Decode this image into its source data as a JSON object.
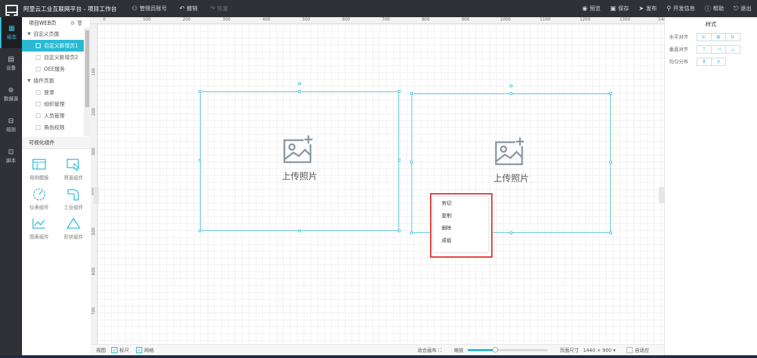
{
  "topbar": {
    "title": "阿里云工业互联网平台 - 项目工作台",
    "admin": "管理员账号",
    "undo": "撤销",
    "redo": "恢复",
    "preview": "预览",
    "save": "保存",
    "publish": "发布",
    "devinfo": "开发信息",
    "help": "帮助",
    "logout": "退出"
  },
  "iconbar": [
    "组态",
    "设备",
    "数据源",
    "规则",
    "脚本"
  ],
  "tree": {
    "header": "项目WEB页",
    "group1": "自定义页面",
    "group1_items": [
      "自定义新增页1",
      "自定义新增页2",
      "OEE服务"
    ],
    "group2": "插件页面",
    "group2_items": [
      "登录",
      "组织管理",
      "人员管理",
      "角色权限"
    ]
  },
  "components": {
    "header": "可视化组件",
    "items": [
      "用例模板",
      "界面组件",
      "仪表组件",
      "工业组件",
      "图表组件",
      "形状组件"
    ]
  },
  "ruler": {
    "x": [
      "0",
      "100",
      "200",
      "300",
      "400",
      "500",
      "600",
      "700",
      "800",
      "900",
      "1000",
      "1100",
      "1200",
      "1300",
      "140"
    ],
    "y": [
      "100",
      "200",
      "300",
      "400",
      "500",
      "600",
      "700"
    ]
  },
  "canvas": {
    "upload_label_1": "上传照片",
    "upload_label_2": "上传照片"
  },
  "context_menu": [
    "剪切",
    "复制",
    "删除",
    "成组"
  ],
  "right_panel": {
    "title": "样式",
    "h_align": "水平对齐",
    "v_align": "垂直对齐",
    "distribute": "均匀分布"
  },
  "bottombar": {
    "view": "视图",
    "ruler": "标尺",
    "grid": "网格",
    "fit": "适合画布",
    "zoom": "缩放",
    "zoom_level": 0.35,
    "page_size_label": "页面尺寸",
    "page_size_value": "1440 × 900",
    "adaptive": "自适应"
  },
  "colors": {
    "accent": "#2ab9d5",
    "topbar": "#2f3136",
    "highlight_box": "#e53935"
  }
}
